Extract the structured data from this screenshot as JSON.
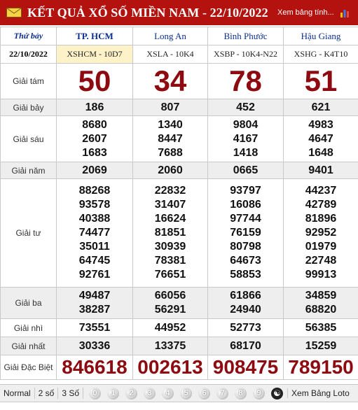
{
  "header": {
    "title": "KẾT QUẢ XỔ SỐ MIỀN NAM - 22/10/2022",
    "view_all": "Xem bảng tính...",
    "accent": "#b3120e"
  },
  "table": {
    "day": "Thứ bảy",
    "date": "22/10/2022",
    "provinces": [
      "TP. HCM",
      "Long An",
      "Bình Phước",
      "Hậu Giang"
    ],
    "codes": [
      "XSHCM - 10D7",
      "XSLA - 10K4",
      "XSBP - 10K4-N22",
      "XSHG - K4T10"
    ],
    "prizes": [
      {
        "label": "Giải tám",
        "values": [
          [
            "50"
          ],
          [
            "34"
          ],
          [
            "78"
          ],
          [
            "51"
          ]
        ]
      },
      {
        "label": "Giải bảy",
        "values": [
          [
            "186"
          ],
          [
            "807"
          ],
          [
            "452"
          ],
          [
            "621"
          ]
        ]
      },
      {
        "label": "Giải sáu",
        "values": [
          [
            "8680",
            "2607",
            "1683"
          ],
          [
            "1340",
            "8447",
            "7688"
          ],
          [
            "9804",
            "4167",
            "1418"
          ],
          [
            "4983",
            "4647",
            "1648"
          ]
        ]
      },
      {
        "label": "Giải năm",
        "values": [
          [
            "2069"
          ],
          [
            "2060"
          ],
          [
            "0665"
          ],
          [
            "9401"
          ]
        ]
      },
      {
        "label": "Giải tư",
        "values": [
          [
            "88268",
            "93578",
            "40388",
            "74477",
            "35011",
            "64745",
            "92761"
          ],
          [
            "22832",
            "31407",
            "16624",
            "81851",
            "30939",
            "78381",
            "76651"
          ],
          [
            "93797",
            "16086",
            "97744",
            "76159",
            "80798",
            "64673",
            "58853"
          ],
          [
            "44237",
            "42789",
            "81896",
            "92952",
            "01979",
            "22748",
            "99913"
          ]
        ]
      },
      {
        "label": "Giải ba",
        "values": [
          [
            "49487",
            "38287"
          ],
          [
            "66056",
            "56291"
          ],
          [
            "61866",
            "24940"
          ],
          [
            "34859",
            "68820"
          ]
        ]
      },
      {
        "label": "Giải nhì",
        "values": [
          [
            "73551"
          ],
          [
            "44952"
          ],
          [
            "52773"
          ],
          [
            "56385"
          ]
        ]
      },
      {
        "label": "Giải nhất",
        "values": [
          [
            "30336"
          ],
          [
            "13375"
          ],
          [
            "68170"
          ],
          [
            "15259"
          ]
        ]
      },
      {
        "label": "Giải Đặc Biệt",
        "values": [
          [
            "846618"
          ],
          [
            "002613"
          ],
          [
            "908475"
          ],
          [
            "789150"
          ]
        ]
      }
    ]
  },
  "footer": {
    "options": [
      "Normal",
      "2 số",
      "3 Số"
    ],
    "digits": [
      "0",
      "1",
      "2",
      "3",
      "4",
      "5",
      "6",
      "7",
      "8",
      "9"
    ],
    "loto_link": "Xem Bảng Loto"
  }
}
